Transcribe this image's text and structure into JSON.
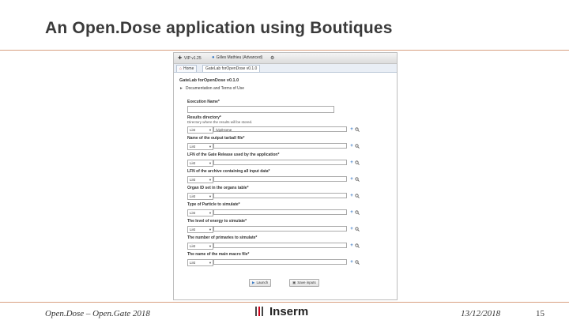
{
  "slide": {
    "title": "An Open.Dose application using Boutiques",
    "footer_left": "Open.Dose – Open.Gate 2018",
    "footer_date": "13/12/2018",
    "page_number": "15",
    "logo_text": "Inserm"
  },
  "app": {
    "topbar": {
      "vip_version": "VIP v1.25",
      "user": "Gilles Mathieu (Advanced)"
    },
    "tabs": [
      {
        "label": "Home"
      },
      {
        "label": "GateLab forOpenDose v0.1.0"
      }
    ],
    "heading": "GateLab forOpenDose v0.1.0",
    "section": "Documentation and Terms of Use",
    "execution_name_label": "Execution Name*",
    "result_dir_label": "Results directory*",
    "result_dir_help": "Directory where the results will be stored.",
    "fields": [
      {
        "label": "Results directory*",
        "select": "List",
        "value": "/vip/Home"
      },
      {
        "label": "Name of the output tarball file*",
        "select": "List",
        "value": ""
      },
      {
        "label": "LFN of the Gate Release used by the application*",
        "select": "List",
        "value": ""
      },
      {
        "label": "LFN of the archive containing all input data*",
        "select": "List",
        "value": ""
      },
      {
        "label": "Organ ID set in the organs table*",
        "select": "List",
        "value": ""
      },
      {
        "label": "Type of Particle to simulate*",
        "select": "List",
        "value": ""
      },
      {
        "label": "The level of energy to simulate*",
        "select": "List",
        "value": ""
      },
      {
        "label": "The number of primaries to simulate*",
        "select": "List",
        "value": ""
      },
      {
        "label": "The name of the main macro file*",
        "select": "List",
        "value": ""
      }
    ],
    "buttons": {
      "launch": "Launch",
      "save_inputs": "Save inputs"
    }
  }
}
